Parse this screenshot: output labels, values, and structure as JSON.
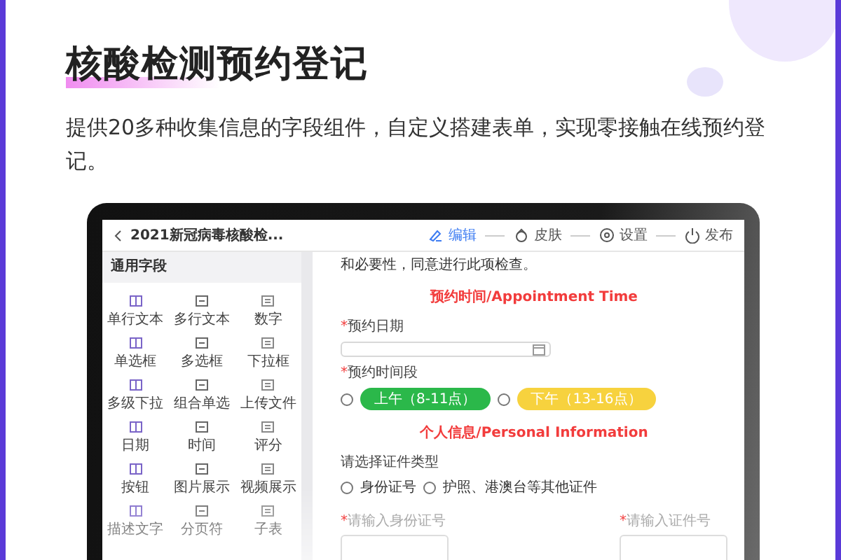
{
  "title": "核酸检测预约登记",
  "description": "提供20多种收集信息的字段组件，自定义搭建表单，实现零接触在线预约登记。",
  "app": {
    "form_title": "2021新冠病毒核酸检...",
    "steps": [
      {
        "label": "编辑",
        "selected": true
      },
      {
        "label": "皮肤",
        "selected": false
      },
      {
        "label": "设置",
        "selected": false
      },
      {
        "label": "发布",
        "selected": false
      }
    ],
    "sidebar": {
      "heading": "通用字段",
      "items": [
        {
          "label": "单行文本"
        },
        {
          "label": "多行文本"
        },
        {
          "label": "数字"
        },
        {
          "label": "单选框"
        },
        {
          "label": "多选框"
        },
        {
          "label": "下拉框"
        },
        {
          "label": "多级下拉"
        },
        {
          "label": "组合单选"
        },
        {
          "label": "上传文件"
        },
        {
          "label": "日期"
        },
        {
          "label": "时间"
        },
        {
          "label": "评分"
        },
        {
          "label": "按钮"
        },
        {
          "label": "图片展示"
        },
        {
          "label": "视频展示"
        },
        {
          "label": "描述文字"
        },
        {
          "label": "分页符"
        },
        {
          "label": "子表"
        }
      ]
    },
    "form": [
      {
        "kind": "note",
        "text": "和必要性，同意进行此项检查。"
      },
      {
        "kind": "heading",
        "text": "预约时间/Appointment Time"
      },
      {
        "kind": "date",
        "mark": "*",
        "label": "预约日期"
      },
      {
        "kind": "pills",
        "mark": "*",
        "label": "预约时间段",
        "options": [
          {
            "label": "上午（8-11点）",
            "color": "#2bb84a",
            "selected": false
          },
          {
            "label": "下午（13-16点）",
            "color": "#f7d23e",
            "selected": false
          }
        ]
      },
      {
        "kind": "heading",
        "text": "个人信息/Personal Information"
      },
      {
        "kind": "radios",
        "label": "请选择证件类型",
        "options": [
          {
            "label": "身份证号",
            "selected": false
          },
          {
            "label": "护照、港澳台等其他证件",
            "selected": false
          }
        ]
      },
      {
        "kind": "pair",
        "fields": [
          {
            "mark": "*",
            "label": "请输入身份证号"
          },
          {
            "mark": "*",
            "label": "请输入证件号"
          }
        ]
      }
    ]
  }
}
